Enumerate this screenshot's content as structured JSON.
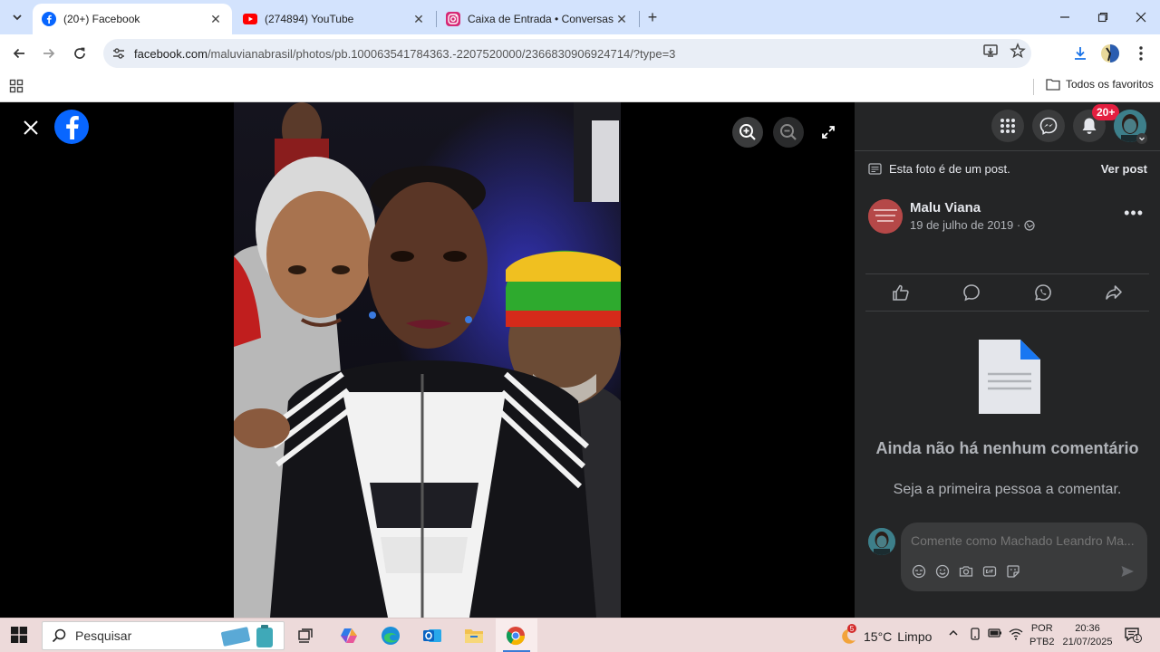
{
  "browser": {
    "tabs": [
      {
        "title": "(20+) Facebook",
        "active": true,
        "icon": "facebook-icon"
      },
      {
        "title": "(274894) YouTube",
        "active": false,
        "icon": "youtube-icon"
      },
      {
        "title": "Caixa de Entrada • Conversas",
        "active": false,
        "icon": "instagram-icon"
      }
    ],
    "url_host": "facebook.com",
    "url_path": "/maluvianabrasil/photos/pb.100063541784363.-2207520000/2366830906924714/?type=3",
    "bookmarks_folder": "Todos os favoritos"
  },
  "panel": {
    "notification_badge": "20+",
    "post_note": "Esta foto é de um post.",
    "see_post": "Ver post",
    "author_name": "Malu Viana",
    "post_date": "19 de julho de 2019 ·",
    "empty_title": "Ainda não há nenhum comentário",
    "empty_subtitle": "Seja a primeira pessoa a comentar.",
    "comment_placeholder": "Comente como Machado Leandro Ma..."
  },
  "taskbar": {
    "search_label": "Pesquisar",
    "weather_temp": "15°C",
    "weather_desc": "Limpo",
    "weather_badge": "5",
    "lang_line1": "POR",
    "lang_line2": "PTB2",
    "time": "20:36",
    "date": "21/07/2025",
    "notif_count": "1"
  },
  "colors": {
    "facebook_blue": "#0866ff",
    "panel_bg": "#242526",
    "badge_red": "#e41e3f",
    "tabstrip_bg": "#d3e3fd"
  }
}
